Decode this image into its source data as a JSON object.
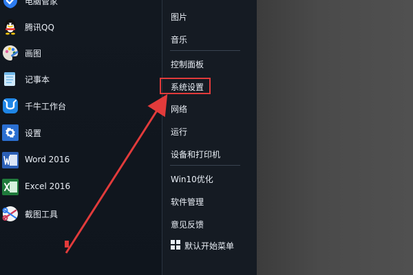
{
  "left_apps": [
    {
      "label": "电脑管家",
      "icon": "shield-icon",
      "color": "#2d7cf0"
    },
    {
      "label": "腾讯QQ",
      "icon": "qq-penguin-icon",
      "color": "#f2c40f"
    },
    {
      "label": "画图",
      "icon": "paint-palette-icon",
      "color": "#e15f9c"
    },
    {
      "label": "记事本",
      "icon": "notepad-icon",
      "color": "#6fb7e8"
    },
    {
      "label": "千牛工作台",
      "icon": "qianniu-icon",
      "color": "#1f86e6"
    },
    {
      "label": "设置",
      "icon": "gear-icon",
      "color": "#2b6fd1"
    },
    {
      "label": "Word 2016",
      "icon": "word-icon",
      "color": "#2b5fb6"
    },
    {
      "label": "Excel 2016",
      "icon": "excel-icon",
      "color": "#1f7a3b"
    },
    {
      "label": "截图工具",
      "icon": "scissors-icon",
      "color": "#cf3b5a"
    }
  ],
  "right_menu": {
    "items": [
      {
        "label": "图片"
      },
      {
        "label": "音乐"
      },
      {
        "label": "控制面板"
      },
      {
        "label": "系统设置"
      },
      {
        "label": "网络"
      },
      {
        "label": "运行"
      },
      {
        "label": "设备和打印机"
      },
      {
        "label": "Win10优化"
      },
      {
        "label": "软件管理"
      },
      {
        "label": "意见反馈"
      },
      {
        "label": "默认开始菜单"
      }
    ],
    "highlighted_label": "系统设置"
  },
  "colors": {
    "highlight": "#e23b3b",
    "arrow": "#e23b3b"
  }
}
